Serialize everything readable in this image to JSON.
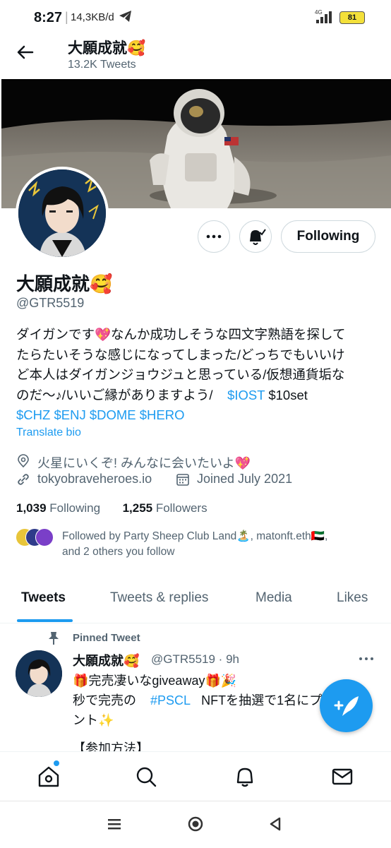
{
  "status_bar": {
    "time": "8:27",
    "network_speed": "14,3KB/d",
    "signal_label": "4G",
    "battery": "81"
  },
  "header": {
    "title": "大願成就🥰",
    "tweet_count": "13.2K Tweets"
  },
  "profile": {
    "name": "大願成就🥰",
    "handle": "@GTR5519",
    "follow_button": "Following",
    "bio_line1": "ダイガンです💖なんか成功しそうな四文字熟語を探して",
    "bio_line2": "たらたいそうな感じになってしまった/どっちでもいいけ",
    "bio_line3": "ど本人はダイガンジョウジュと思っている/仮想通貨垢な",
    "bio_line4_text": "のだ〜♪/いいご縁がありますよう/",
    "bio_tag_iost": "$IOST",
    "bio_tag_10set": "$10set",
    "bio_line5_tags": "$CHZ $ENJ $DOME $HERO",
    "translate": "Translate bio",
    "location": "火星にいくぞ! みんなに会いたいよ💖",
    "website": "tokyobraveheroes.io",
    "joined": "Joined July 2021",
    "following_count": "1,039",
    "following_label": "Following",
    "followers_count": "1,255",
    "followers_label": "Followers",
    "followed_by_line1": "Followed by Party Sheep Club Land🏝️, matonft.eth🇦🇪,",
    "followed_by_line2": "and 2 others you follow"
  },
  "tabs": [
    {
      "label": "Tweets"
    },
    {
      "label": "Tweets & replies"
    },
    {
      "label": "Media"
    },
    {
      "label": "Likes"
    }
  ],
  "tweet": {
    "pinned_label": "Pinned Tweet",
    "author": "大願成就🥰",
    "handle_time": "@GTR5519 · 9h",
    "line1": "🎁完売凄いなgiveaway🎁🎉",
    "line2_pre": "秒で完売の",
    "line2_tag": "#PSCL",
    "line2_post": "NFTを抽選で1名にプ",
    "line3": "ント✨",
    "line4": "【参加方法】"
  },
  "colors": {
    "accent": "#1d9bf0",
    "secondary_text": "#536471"
  }
}
